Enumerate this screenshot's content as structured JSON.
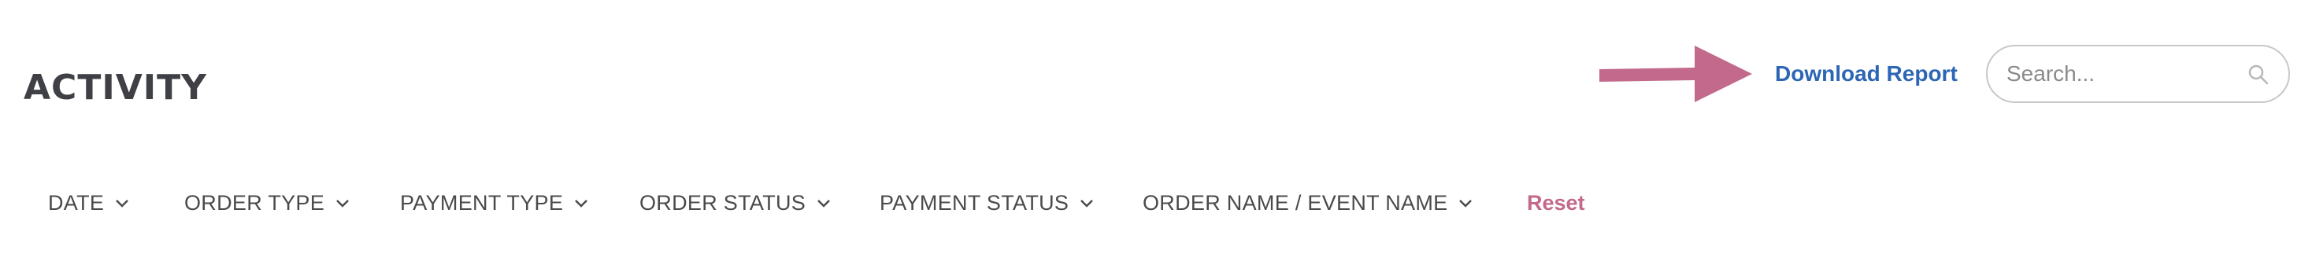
{
  "header": {
    "title": "ACTIVITY",
    "download_label": "Download Report",
    "arrow_icon": "arrow-right-icon",
    "arrow_color": "#c2698c",
    "link_color": "#2d66b5"
  },
  "search": {
    "placeholder": "Search...",
    "value": "",
    "icon": "search-icon"
  },
  "filters": [
    {
      "label": "DATE",
      "icon": "chevron-down-icon"
    },
    {
      "label": "ORDER TYPE",
      "icon": "chevron-down-icon"
    },
    {
      "label": "PAYMENT TYPE",
      "icon": "chevron-down-icon"
    },
    {
      "label": "ORDER STATUS",
      "icon": "chevron-down-icon"
    },
    {
      "label": "PAYMENT STATUS",
      "icon": "chevron-down-icon"
    },
    {
      "label": "ORDER NAME / EVENT NAME",
      "icon": "chevron-down-icon"
    }
  ],
  "reset_label": "Reset",
  "reset_color": "#c2698c"
}
